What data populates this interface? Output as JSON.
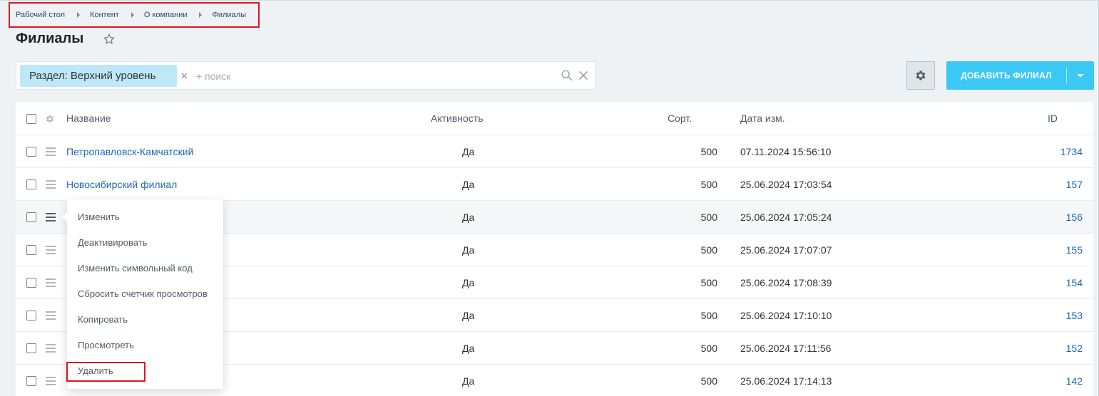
{
  "breadcrumb": [
    "Рабочий стол",
    "Контент",
    "О компании",
    "Филиалы"
  ],
  "page_title": "Филиалы",
  "filter": {
    "tag_label": "Раздел: Верхний уровень",
    "search_placeholder": "+ поиск",
    "search_value": ""
  },
  "toolbar": {
    "add_button_label": "ДОБАВИТЬ ФИЛИАЛ"
  },
  "colors": {
    "accent": "#3bc8f5",
    "link": "#2067b0",
    "highlight": "#e0141e",
    "tag_bg": "#bde8f8"
  },
  "grid": {
    "columns": {
      "name": "Название",
      "active": "Активность",
      "sort": "Сорт.",
      "date": "Дата изм.",
      "id": "ID"
    },
    "rows": [
      {
        "name": "Петропавловск-Камчатский",
        "active": "Да",
        "sort": "500",
        "date": "07.11.2024 15:56:10",
        "id": "1734"
      },
      {
        "name": "Новосибирский филиал",
        "active": "Да",
        "sort": "500",
        "date": "25.06.2024 17:03:54",
        "id": "157"
      },
      {
        "name": "",
        "active": "Да",
        "sort": "500",
        "date": "25.06.2024 17:05:24",
        "id": "156"
      },
      {
        "name": "",
        "active": "Да",
        "sort": "500",
        "date": "25.06.2024 17:07:07",
        "id": "155"
      },
      {
        "name": "",
        "active": "Да",
        "sort": "500",
        "date": "25.06.2024 17:08:39",
        "id": "154"
      },
      {
        "name": "",
        "active": "Да",
        "sort": "500",
        "date": "25.06.2024 17:10:10",
        "id": "153"
      },
      {
        "name": "",
        "active": "Да",
        "sort": "500",
        "date": "25.06.2024 17:11:56",
        "id": "152"
      },
      {
        "name": "",
        "active": "Да",
        "sort": "500",
        "date": "25.06.2024 17:14:13",
        "id": "142"
      }
    ]
  },
  "context_menu": {
    "items": [
      "Изменить",
      "Деактивировать",
      "Изменить символьный код",
      "Сбросить счетчик просмотров",
      "Копировать",
      "Просмотреть",
      "Удалить"
    ]
  }
}
